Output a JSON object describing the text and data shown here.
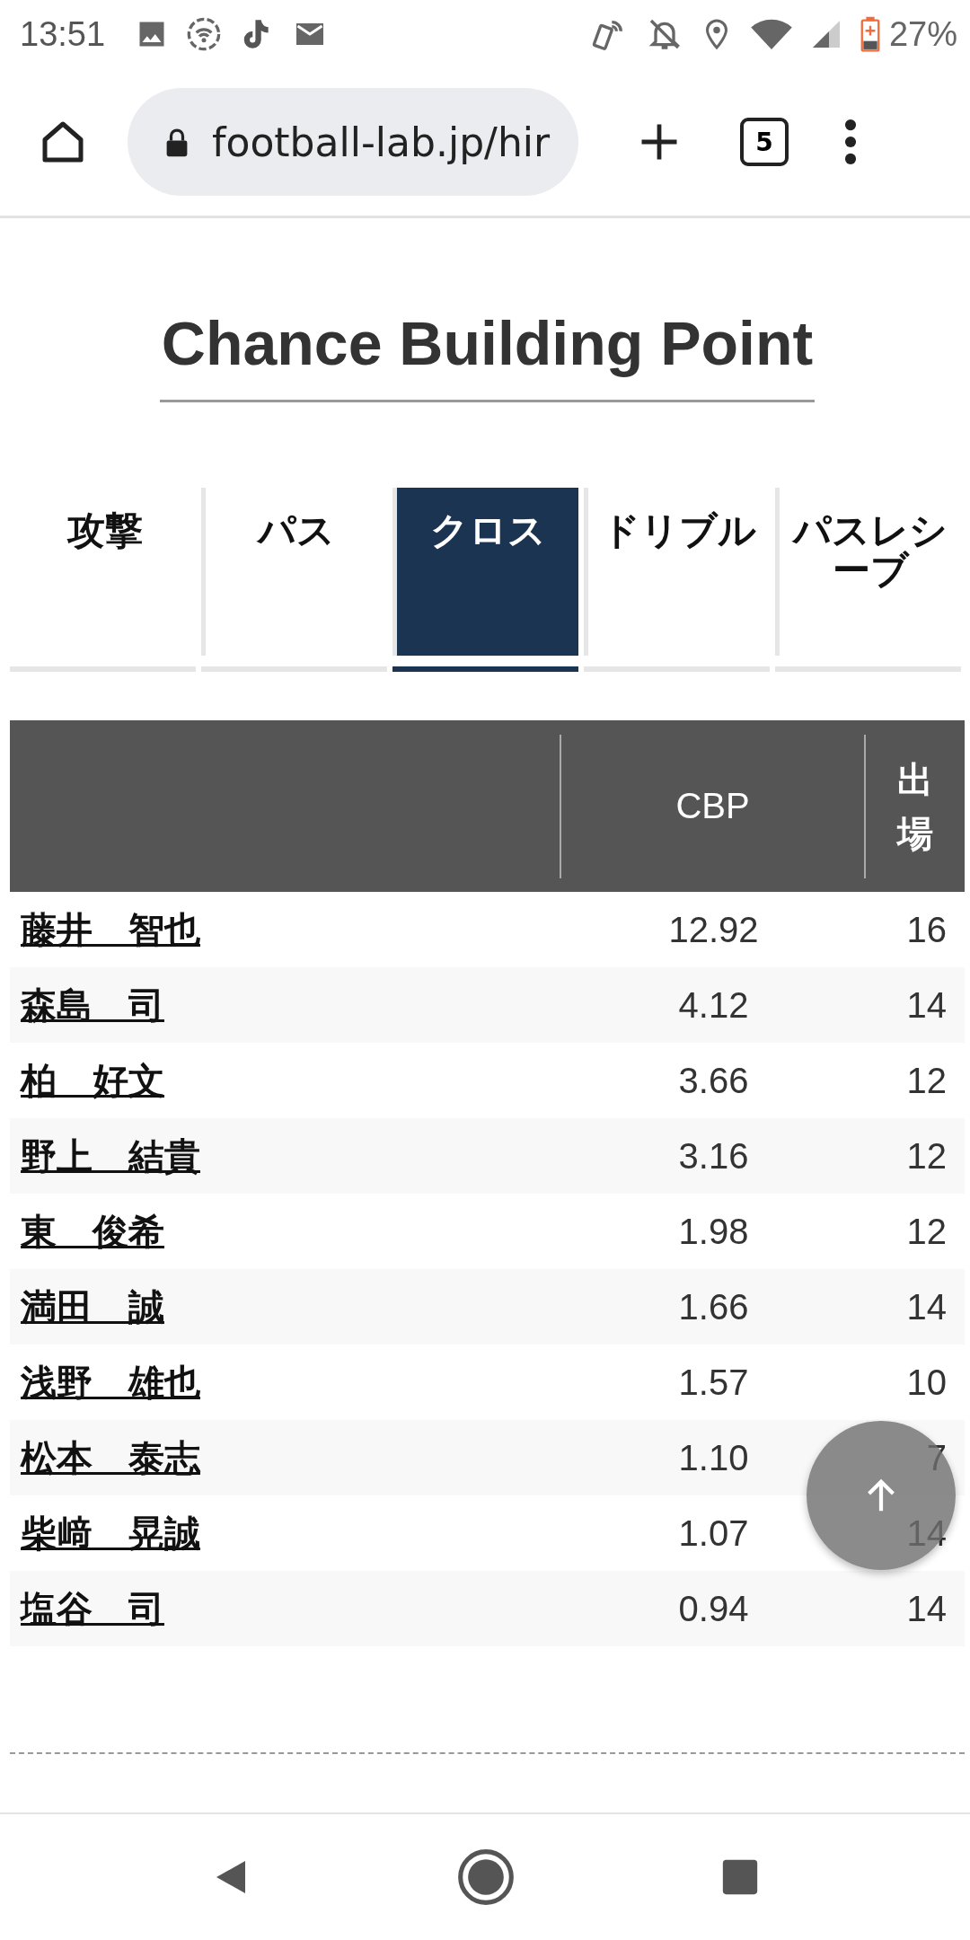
{
  "status_bar": {
    "time": "13:51",
    "battery": "27%"
  },
  "browser": {
    "url": "football-lab.jp/hir",
    "tab_count": "5"
  },
  "title": "Chance Building Point",
  "tabs": [
    {
      "label": "攻撃",
      "selected": false
    },
    {
      "label": "パス",
      "selected": false
    },
    {
      "label": "クロス",
      "selected": true
    },
    {
      "label": "ドリブル",
      "selected": false
    },
    {
      "label": "パスレシーブ",
      "selected": false
    }
  ],
  "table": {
    "columns": [
      "CBP",
      "出場"
    ],
    "rows": [
      {
        "name": "藤井　智也",
        "cbp": "12.92",
        "apps": "16"
      },
      {
        "name": "森島　司",
        "cbp": "4.12",
        "apps": "14"
      },
      {
        "name": "柏　好文",
        "cbp": "3.66",
        "apps": "12"
      },
      {
        "name": "野上　結貴",
        "cbp": "3.16",
        "apps": "12"
      },
      {
        "name": "東　俊希",
        "cbp": "1.98",
        "apps": "12"
      },
      {
        "name": "満田　誠",
        "cbp": "1.66",
        "apps": "14"
      },
      {
        "name": "浅野　雄也",
        "cbp": "1.57",
        "apps": "10"
      },
      {
        "name": "松本　泰志",
        "cbp": "1.10",
        "apps": "7"
      },
      {
        "name": "柴﨑　晃誠",
        "cbp": "1.07",
        "apps": "14"
      },
      {
        "name": "塩谷　司",
        "cbp": "0.94",
        "apps": "14"
      }
    ]
  }
}
